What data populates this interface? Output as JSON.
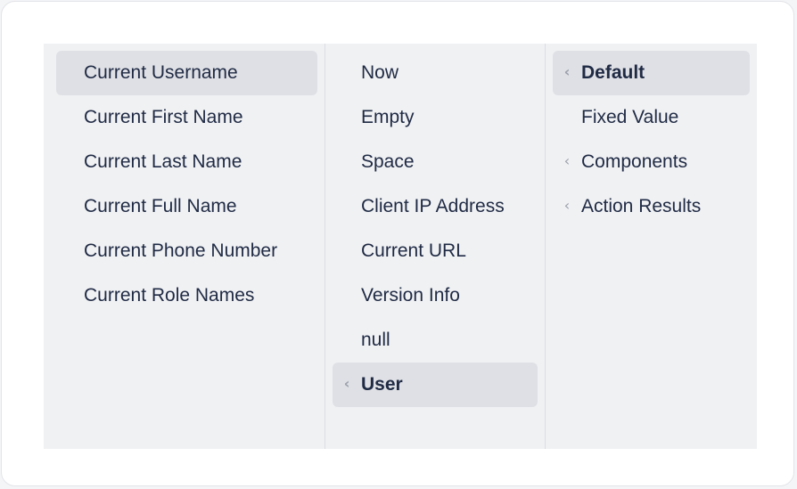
{
  "columns": {
    "col1": {
      "items": [
        {
          "label": "Current Username",
          "active": true
        },
        {
          "label": "Current First Name"
        },
        {
          "label": "Current Last Name"
        },
        {
          "label": "Current Full Name"
        },
        {
          "label": "Current Phone Number"
        },
        {
          "label": "Current Role Names"
        }
      ]
    },
    "col2": {
      "items": [
        {
          "label": "Now"
        },
        {
          "label": "Empty"
        },
        {
          "label": "Space"
        },
        {
          "label": "Client IP Address"
        },
        {
          "label": "Current URL"
        },
        {
          "label": "Version Info"
        },
        {
          "label": "null"
        },
        {
          "label": "User",
          "active": true,
          "has_children": true
        }
      ]
    },
    "col3": {
      "items": [
        {
          "label": "Default",
          "active": true,
          "has_children": true
        },
        {
          "label": "Fixed Value"
        },
        {
          "label": "Components",
          "has_children": true
        },
        {
          "label": "Action Results",
          "has_children": true
        }
      ]
    }
  },
  "icons": {
    "expand": "chevron-left-icon"
  },
  "colors": {
    "panel_bg": "#f0f1f3",
    "active_bg": "#dfe0e5",
    "text": "#1f2a44",
    "chevron": "#9a9fab"
  }
}
